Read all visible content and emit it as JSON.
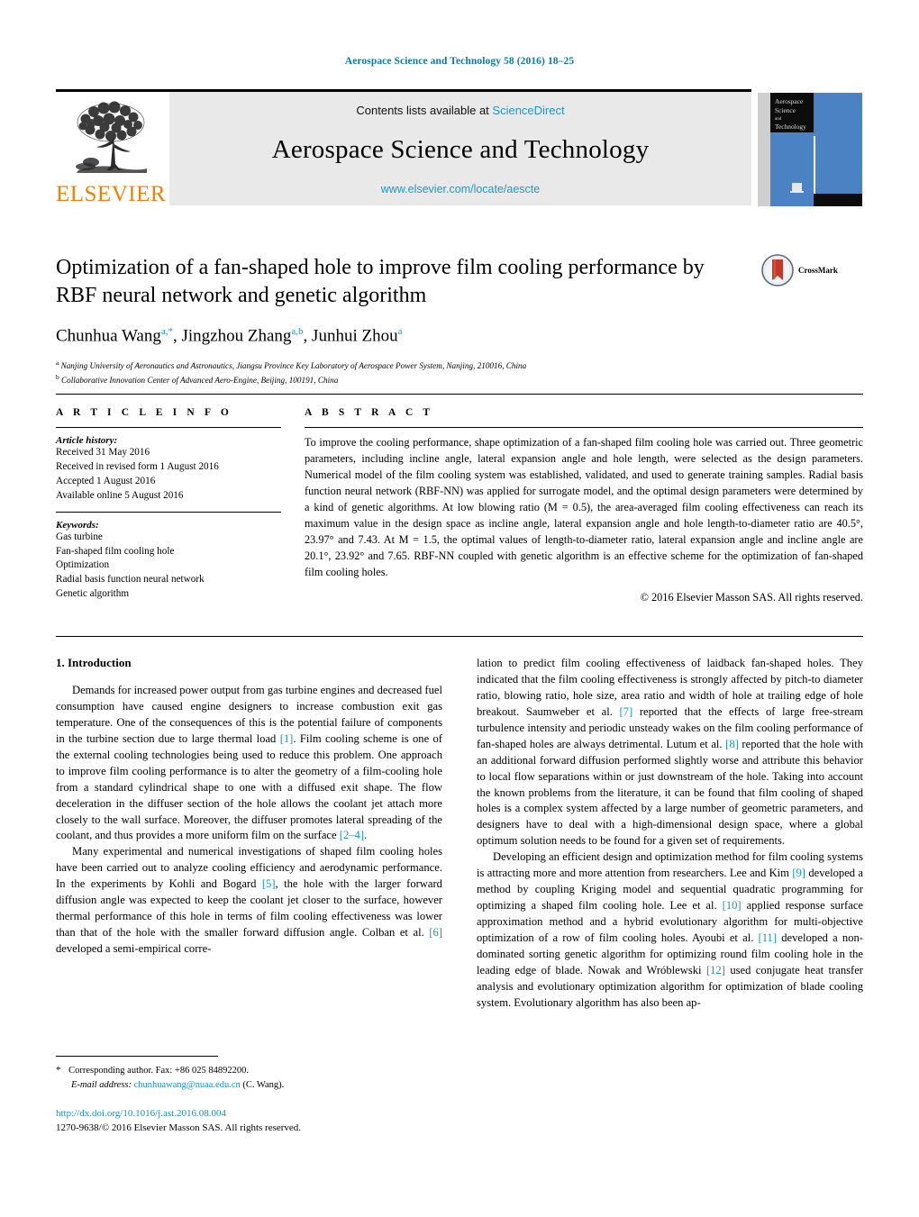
{
  "running_head": "Aerospace Science and Technology 58 (2016) 18–25",
  "masthead": {
    "contents_prefix": "Contents lists available at ",
    "sciencedirect": "ScienceDirect",
    "journal_name": "Aerospace Science and Technology",
    "journal_url": "www.elsevier.com/locate/aescte",
    "publisher_wordmark": "ELSEVIER",
    "cover_lines": [
      "Aerospace",
      "Science",
      "and",
      "Technology"
    ]
  },
  "title_block": {
    "title": "Optimization of a fan-shaped hole to improve film cooling performance by RBF neural network and genetic algorithm",
    "authors": [
      {
        "name": "Chunhua Wang",
        "sup": "a,*"
      },
      {
        "name": "Jingzhou Zhang",
        "sup": "a,b"
      },
      {
        "name": "Junhui Zhou",
        "sup": "a"
      }
    ],
    "affiliations": [
      {
        "marker": "a",
        "text": "Nanjing University of Aeronautics and Astronautics, Jiangsu Province Key Laboratory of Aerospace Power System, Nanjing, 210016, China"
      },
      {
        "marker": "b",
        "text": "Collaborative Innovation Center of Advanced Aero-Engine, Beijing, 100191, China"
      }
    ],
    "crossmark_label": "CrossMark"
  },
  "article_info": {
    "heading": "A R T I C L E  I N F O",
    "history_label": "Article history:",
    "history": [
      "Received 31 May 2016",
      "Received in revised form 1 August 2016",
      "Accepted 1 August 2016",
      "Available online 5 August 2016"
    ],
    "keywords_label": "Keywords:",
    "keywords": [
      "Gas turbine",
      "Fan-shaped film cooling hole",
      "Optimization",
      "Radial basis function neural network",
      "Genetic algorithm"
    ]
  },
  "abstract": {
    "heading": "A B S T R A C T",
    "text": "To improve the cooling performance, shape optimization of a fan-shaped film cooling hole was carried out. Three geometric parameters, including incline angle, lateral expansion angle and hole length, were selected as the design parameters. Numerical model of the film cooling system was established, validated, and used to generate training samples. Radial basis function neural network (RBF-NN) was applied for surrogate model, and the optimal design parameters were determined by a kind of genetic algorithms. At low blowing ratio (M = 0.5), the area-averaged film cooling effectiveness can reach its maximum value in the design space as incline angle, lateral expansion angle and hole length-to-diameter ratio are 40.5°, 23.97° and 7.43. At M = 1.5, the optimal values of length-to-diameter ratio, lateral expansion angle and incline angle are 20.1°, 23.92° and 7.65. RBF-NN coupled with genetic algorithm is an effective scheme for the optimization of fan-shaped film cooling holes.",
    "copyright": "© 2016 Elsevier Masson SAS. All rights reserved."
  },
  "body": {
    "section_title": "1. Introduction",
    "left_paragraphs": [
      "Demands for increased power output from gas turbine engines and decreased fuel consumption have caused engine designers to increase combustion exit gas temperature. One of the consequences of this is the potential failure of components in the turbine section due to large thermal load [1]. Film cooling scheme is one of the external cooling technologies being used to reduce this problem. One approach to improve film cooling performance is to alter the geometry of a film-cooling hole from a standard cylindrical shape to one with a diffused exit shape. The flow deceleration in the diffuser section of the hole allows the coolant jet attach more closely to the wall surface. Moreover, the diffuser promotes lateral spreading of the coolant, and thus provides a more uniform film on the surface [2–4].",
      "Many experimental and numerical investigations of shaped film cooling holes have been carried out to analyze cooling efficiency and aerodynamic performance. In the experiments by Kohli and Bogard [5], the hole with the larger forward diffusion angle was expected to keep the coolant jet closer to the surface, however thermal performance of this hole in terms of film cooling effectiveness was lower than that of the hole with the smaller forward diffusion angle. Colban et al. [6] developed a semi-empirical corre-"
    ],
    "right_paragraphs": [
      "lation to predict film cooling effectiveness of laidback fan-shaped holes. They indicated that the film cooling effectiveness is strongly affected by pitch-to diameter ratio, blowing ratio, hole size, area ratio and width of hole at trailing edge of hole breakout. Saumweber et al. [7] reported that the effects of large free-stream turbulence intensity and periodic unsteady wakes on the film cooling performance of fan-shaped holes are always detrimental. Lutum et al. [8] reported that the hole with an additional forward diffusion performed slightly worse and attribute this behavior to local flow separations within or just downstream of the hole. Taking into account the known problems from the literature, it can be found that film cooling of shaped holes is a complex system affected by a large number of geometric parameters, and designers have to deal with a high-dimensional design space, where a global optimum solution needs to be found for a given set of requirements.",
      "Developing an efficient design and optimization method for film cooling systems is attracting more and more attention from researchers. Lee and Kim [9] developed a method by coupling Kriging model and sequential quadratic programming for optimizing a shaped film cooling hole. Lee et al. [10] applied response surface approximation method and a hybrid evolutionary algorithm for multi-objective optimization of a row of film cooling holes. Ayoubi et al. [11] developed a non-dominated sorting genetic algorithm for optimizing round film cooling hole in the leading edge of blade. Nowak and Wróblewski [12] used conjugate heat transfer analysis and evolutionary optimization algorithm for optimization of blade cooling system. Evolutionary algorithm has also been ap-"
    ]
  },
  "footer": {
    "corresponding_star": "*",
    "corresponding_text": "Corresponding author. Fax: +86 025 84892200.",
    "email_label": "E-mail address:",
    "email": "chunhuawang@nuaa.edu.cn",
    "email_suffix": "(C. Wang).",
    "doi": "http://dx.doi.org/10.1016/j.ast.2016.08.004",
    "issn_line_prefix": "1270-9638/",
    "issn_line_rest": "© 2016 Elsevier Masson SAS. All rights reserved."
  },
  "colors": {
    "link": "#1b8fc0",
    "running_head": "#0b7aa5",
    "elsevier_orange": "#f08000",
    "cover_blue": "#4a82c4",
    "banner_grey": "#e9e9e9"
  }
}
